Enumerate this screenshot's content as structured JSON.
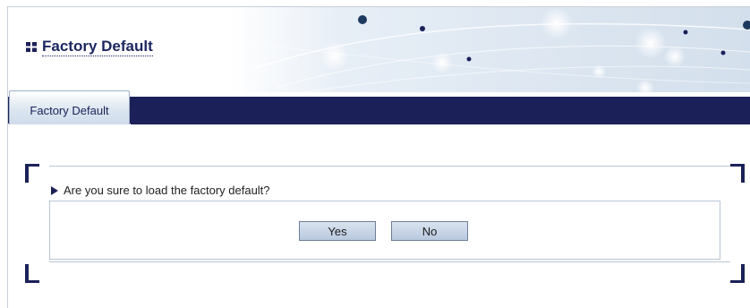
{
  "header": {
    "title": "Factory Default",
    "title_icon": "grid-squares-icon"
  },
  "tabs": [
    {
      "label": "Factory Default",
      "active": true
    }
  ],
  "dialog": {
    "question": "Are you sure to load the factory default?",
    "question_icon": "triangle-right-icon",
    "yes_label": "Yes",
    "no_label": "No"
  },
  "colors": {
    "navy": "#1b2158",
    "title": "#1c2761",
    "border": "#b9c6d8",
    "button_fill": "#c5d4e6"
  }
}
